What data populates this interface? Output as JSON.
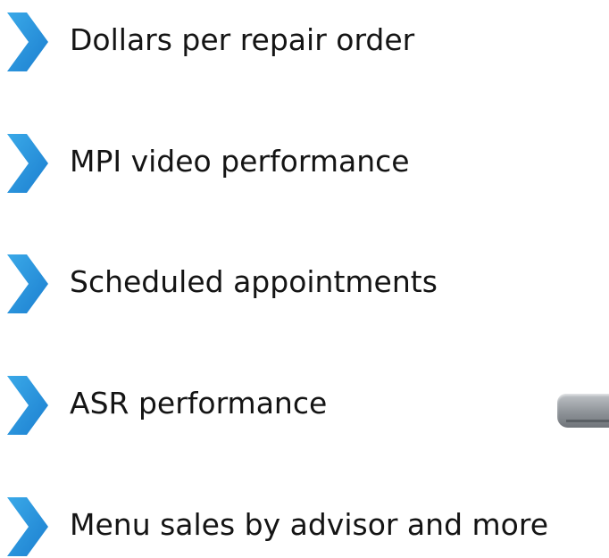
{
  "features": [
    {
      "label": "Dollars per repair order",
      "icon": "chevron-right-icon"
    },
    {
      "label": "MPI video performance",
      "icon": "chevron-right-icon"
    },
    {
      "label": "Scheduled appointments",
      "icon": "chevron-right-icon"
    },
    {
      "label": "ASR performance",
      "icon": "chevron-right-icon"
    },
    {
      "label": "Menu sales by advisor and more",
      "icon": "chevron-right-icon"
    }
  ],
  "colors": {
    "chevron_light": "#3aa9e8",
    "chevron_dark": "#1c7fd0",
    "text": "#141414",
    "background": "#ffffff"
  }
}
